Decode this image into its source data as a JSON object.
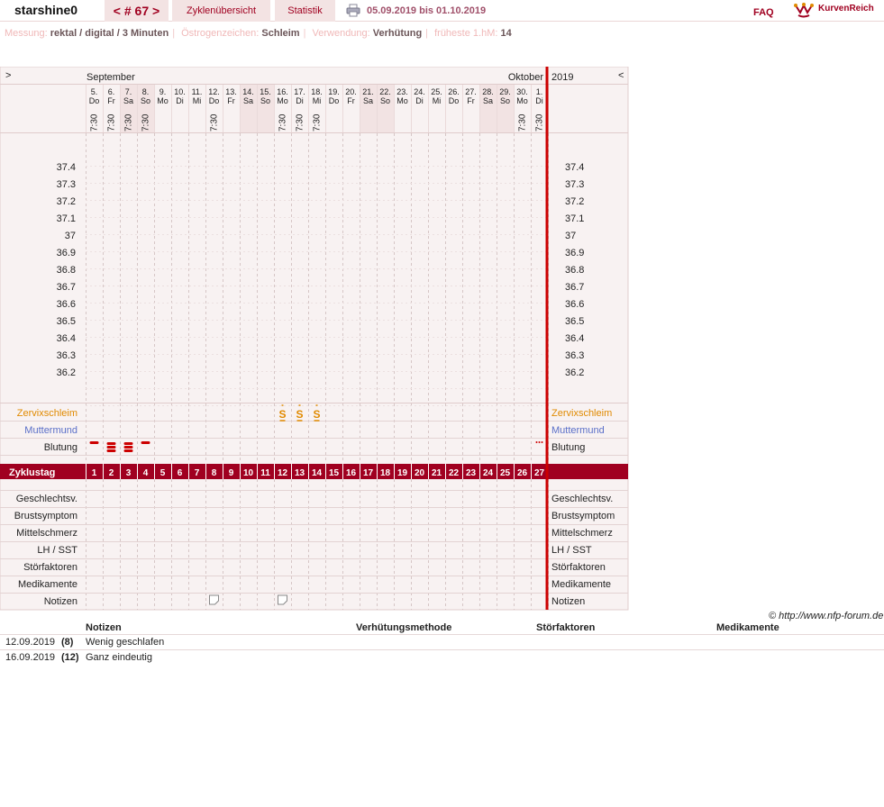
{
  "header": {
    "username": "starshine0",
    "cycle_nav": "< # 67 >",
    "tab_overview": "Zyklenübersicht",
    "tab_stats": "Statistik",
    "date_range": "05.09.2019 bis 01.10.2019",
    "faq": "FAQ",
    "brand": "KurvenReich"
  },
  "meta": {
    "l1": "Messung:",
    "v1": "rektal / digital / 3 Minuten",
    "l2": "Östrogenzeichen:",
    "v2": "Schleim",
    "l3": "Verwendung:",
    "v3": "Verhütung",
    "l4": "früheste 1.hM:",
    "v4": "14"
  },
  "chart": {
    "nav_left": ">",
    "nav_right": "<",
    "month_left": "September",
    "month_right": "Oktober",
    "year": "2019",
    "dates": [
      "5.",
      "6.",
      "7.",
      "8.",
      "9.",
      "10.",
      "11.",
      "12.",
      "13.",
      "14.",
      "15.",
      "16.",
      "17.",
      "18.",
      "19.",
      "20.",
      "21.",
      "22.",
      "23.",
      "24.",
      "25.",
      "26.",
      "27.",
      "28.",
      "29.",
      "30.",
      "1."
    ],
    "weekdays": [
      "Do",
      "Fr",
      "Sa",
      "So",
      "Mo",
      "Di",
      "Mi",
      "Do",
      "Fr",
      "Sa",
      "So",
      "Mo",
      "Di",
      "Mi",
      "Do",
      "Fr",
      "Sa",
      "So",
      "Mo",
      "Di",
      "Mi",
      "Do",
      "Fr",
      "Sa",
      "So",
      "Mo",
      "Di"
    ],
    "times": [
      "7:30",
      "7:30",
      "7:30",
      "7:30",
      "",
      "",
      "",
      "7:30",
      "",
      "",
      "",
      "7:30",
      "7:30",
      "7:30",
      "",
      "",
      "",
      "",
      "",
      "",
      "",
      "",
      "",
      "",
      "",
      "7:30",
      "7:30"
    ],
    "temp_labels": [
      "37.4",
      "37.3",
      "37.2",
      "37.1",
      "37",
      "36.9",
      "36.8",
      "36.7",
      "36.6",
      "36.5",
      "36.4",
      "36.3",
      "36.2"
    ],
    "row_labels": {
      "cervix": "Zervixschleim",
      "cervix_pos": "Muttermund",
      "bleeding": "Blutung",
      "cycle_day": "Zyklustag",
      "sex": "Geschlechtsv.",
      "breast": "Brustsymptom",
      "midpain": "Mittelschmerz",
      "lh": "LH / SST",
      "disturb": "Störfaktoren",
      "meds": "Medikamente",
      "notes": "Notizen"
    },
    "cycle_days": [
      "1",
      "2",
      "3",
      "4",
      "5",
      "6",
      "7",
      "8",
      "9",
      "10",
      "11",
      "12",
      "13",
      "14",
      "15",
      "16",
      "17",
      "18",
      "19",
      "20",
      "21",
      "22",
      "23",
      "24",
      "25",
      "26",
      "27"
    ],
    "mucus_days": [
      12,
      13,
      14
    ],
    "mucus_symbol": "S",
    "bleeding": [
      {
        "day": 1,
        "level": "light"
      },
      {
        "day": 2,
        "level": "heavy"
      },
      {
        "day": 3,
        "level": "heavy"
      },
      {
        "day": 4,
        "level": "light"
      },
      {
        "day": 27,
        "level": "spotting"
      }
    ],
    "note_days": [
      8,
      12
    ],
    "weekend_days": [
      3,
      4,
      10,
      11,
      17,
      18,
      24,
      25
    ]
  },
  "copyright": "© http://www.nfp-forum.de",
  "notes_table": {
    "headers": {
      "notes": "Notizen",
      "method": "Verhütungsmethode",
      "disturb": "Störfaktoren",
      "meds": "Medikamente"
    },
    "rows": [
      {
        "date": "12.09.2019",
        "day": "(8)",
        "note": "Wenig geschlafen"
      },
      {
        "date": "16.09.2019",
        "day": "(12)",
        "note": "Ganz eindeutig"
      }
    ]
  },
  "colors": {
    "accent": "#a00020",
    "grid_bg": "#f8f2f2",
    "weekend": "#f2e3e3",
    "mucus": "#e08a00",
    "cervix_label": "#e08a00",
    "cervix_pos_label": "#5a6fc8",
    "today_line": "#cc0000"
  }
}
